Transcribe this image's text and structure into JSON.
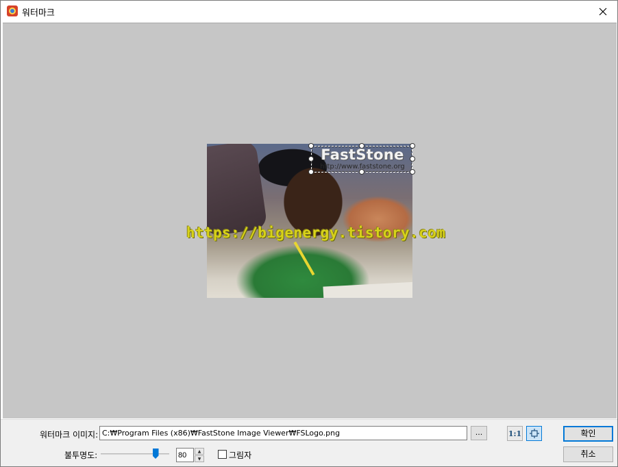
{
  "window": {
    "title": "워터마크"
  },
  "preview": {
    "watermark_title": "FastStone",
    "watermark_url": "http://www.faststone.org",
    "overlay_text": "https://bigenergy.tistory.com"
  },
  "controls": {
    "watermark_image_label": "워터마크 이미지:",
    "watermark_image_path": "C:₩Program Files (x86)₩FastStone Image Viewer₩FSLogo.png",
    "browse_label": "...",
    "actual_size_label": "1:1",
    "opacity_label": "불투명도:",
    "opacity_value": "80",
    "opacity_fraction": 0.8,
    "shadow_label": "그림자",
    "shadow_checked": false,
    "ok_label": "확인",
    "cancel_label": "취소"
  },
  "colors": {
    "accent": "#0078d7",
    "preview_bg": "#c6c6c6",
    "overlay_text": "#d8d21a"
  }
}
